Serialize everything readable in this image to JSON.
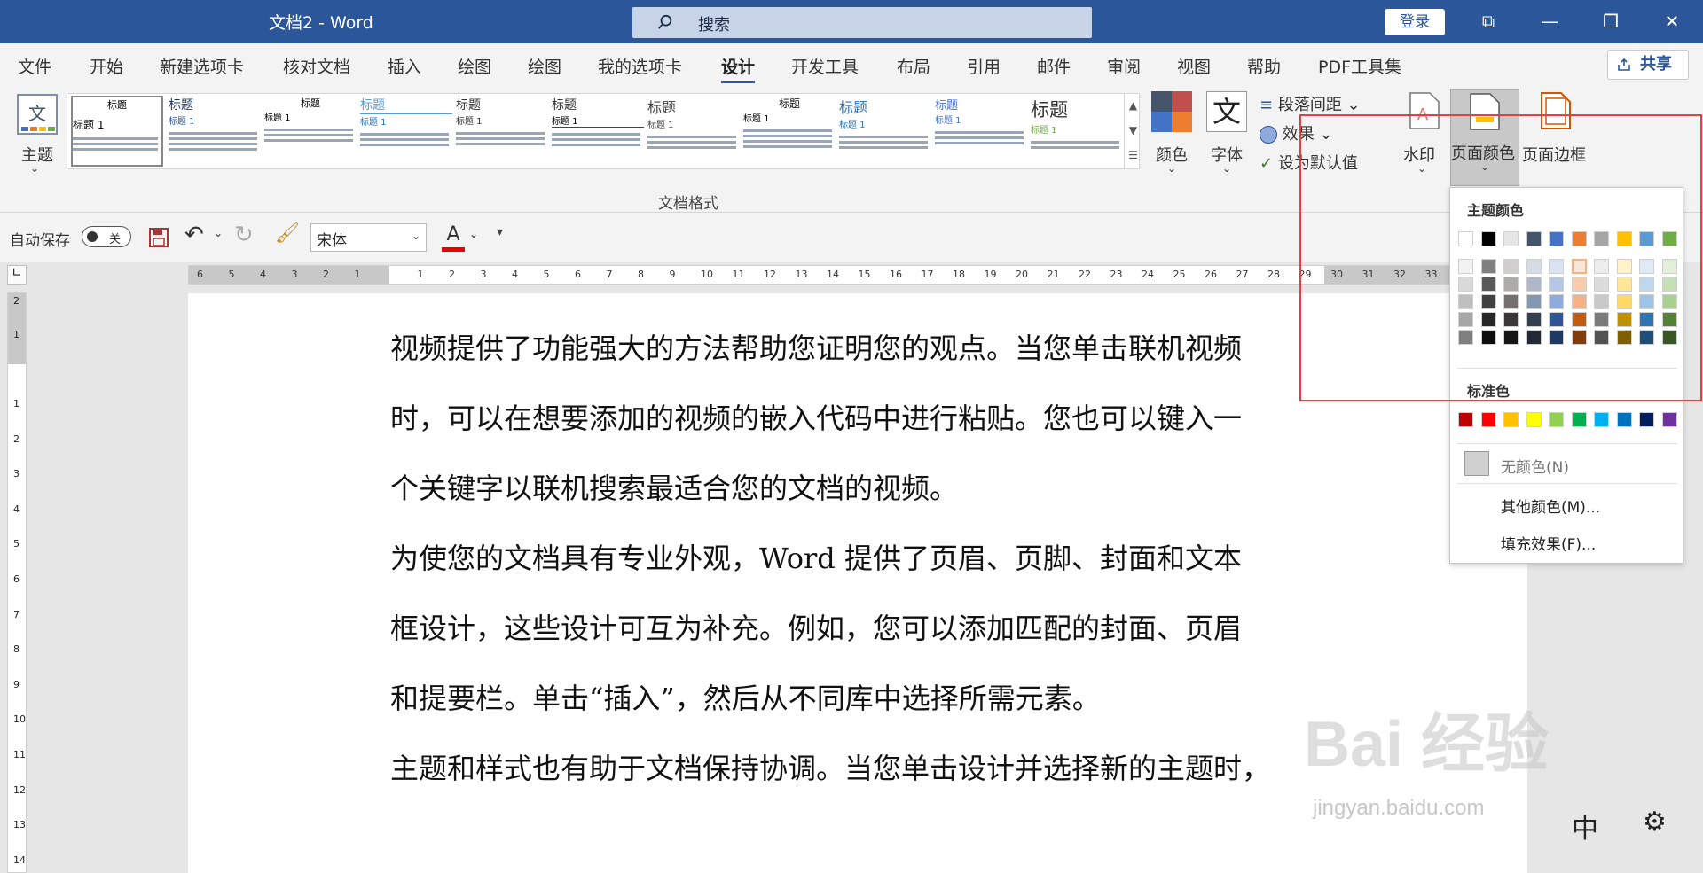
{
  "titlebar": {
    "title": "文档2  -  Word",
    "search_text": "搜索",
    "login_label": "登录"
  },
  "menu": {
    "tabs": [
      "文件",
      "开始",
      "新建选项卡",
      "核对文档",
      "插入",
      "绘图",
      "绘图",
      "我的选项卡",
      "设计",
      "开发工具",
      "布局",
      "引用",
      "邮件",
      "审阅",
      "视图",
      "帮助",
      "PDF工具集"
    ],
    "active_tab": "设计",
    "share_label": "共享"
  },
  "ribbon": {
    "theme_label": "主题",
    "style_heading": "标题",
    "style_heading1": "标题 1",
    "colors_label": "颜色",
    "fonts_label": "字体",
    "font_glyph": "文",
    "paragraph_spacing_label": "段落间距",
    "effects_label": "效果",
    "set_default_label": "设为默认值",
    "watermark_label": "水印",
    "page_color_label": "页面颜色",
    "page_border_label": "页面边框",
    "group_label": "文档格式"
  },
  "qat": {
    "autosave_label": "自动保存",
    "toggle_state": "关",
    "font_name": "宋体"
  },
  "ruler": {
    "h_left": [
      "6",
      "5",
      "4",
      "3",
      "2",
      "1"
    ],
    "h_main": [
      "1",
      "2",
      "3",
      "4",
      "5",
      "6",
      "7",
      "8",
      "9",
      "10",
      "11",
      "12",
      "13",
      "14",
      "15",
      "16",
      "17",
      "18",
      "19",
      "20",
      "21",
      "22",
      "23",
      "24",
      "25",
      "26",
      "27",
      "28",
      "29",
      "30",
      "31",
      "32",
      "33"
    ],
    "v_top": [
      "2",
      "1"
    ],
    "v_main": [
      "1",
      "2",
      "3",
      "4",
      "5",
      "6",
      "7",
      "8",
      "9",
      "10",
      "11",
      "12",
      "13",
      "14"
    ]
  },
  "document": {
    "lines": [
      "视频提供了功能强大的方法帮助您证明您的观点。当您单击联机视频",
      "时，可以在想要添加的视频的嵌入代码中进行粘贴。您也可以键入一",
      "个关键字以联机搜索最适合您的文档的视频。",
      "为使您的文档具有专业外观，Word 提供了页眉、页脚、封面和文本",
      "框设计，这些设计可互为补充。例如，您可以添加匹配的封面、页眉",
      "和提要栏。单击“插入”，然后从不同库中选择所需元素。",
      "主题和样式也有助于文档保持协调。当您单击设计并选择新的主题时，"
    ]
  },
  "color_menu": {
    "theme_colors_title": "主题颜色",
    "standard_colors_title": "标准色",
    "no_color_label": "无颜色(N)",
    "more_colors_label": "其他颜色(M)...",
    "fill_effects_label": "填充效果(F)...",
    "theme_top": [
      "#ffffff",
      "#000000",
      "#e7e6e6",
      "#44546a",
      "#4472c4",
      "#ed7d31",
      "#a5a5a5",
      "#ffc000",
      "#5b9bd5",
      "#70ad47"
    ],
    "theme_columns": [
      [
        "#f2f2f2",
        "#d9d9d9",
        "#bfbfbf",
        "#a6a6a6",
        "#808080"
      ],
      [
        "#808080",
        "#595959",
        "#404040",
        "#262626",
        "#0d0d0d"
      ],
      [
        "#d0cece",
        "#aeabab",
        "#757070",
        "#3a3838",
        "#171616"
      ],
      [
        "#d6dce5",
        "#adb9ca",
        "#8497b0",
        "#333f50",
        "#222a35"
      ],
      [
        "#dae3f3",
        "#b4c7e7",
        "#8faadc",
        "#2f5597",
        "#203864"
      ],
      [
        "#fbe5d6",
        "#f8cbad",
        "#f4b183",
        "#c55a11",
        "#843c0c"
      ],
      [
        "#ededed",
        "#dbdbdb",
        "#c9c9c9",
        "#7b7b7b",
        "#525252"
      ],
      [
        "#fff2cc",
        "#ffe699",
        "#ffd966",
        "#bf9000",
        "#7f6000"
      ],
      [
        "#deebf7",
        "#bdd7ee",
        "#9dc3e6",
        "#2e75b6",
        "#1f4e79"
      ],
      [
        "#e2f0d9",
        "#c5e0b4",
        "#a9d18e",
        "#548235",
        "#385723"
      ]
    ],
    "standard": [
      "#c00000",
      "#ff0000",
      "#ffc000",
      "#ffff00",
      "#92d050",
      "#00b050",
      "#00b0f0",
      "#0070c0",
      "#002060",
      "#7030a0"
    ],
    "highlight_color": "#e34040"
  },
  "watermark": {
    "brand": "Bai 经验",
    "url": "jingyan.baidu.com"
  },
  "statusbar": {
    "ime_label": "中"
  }
}
